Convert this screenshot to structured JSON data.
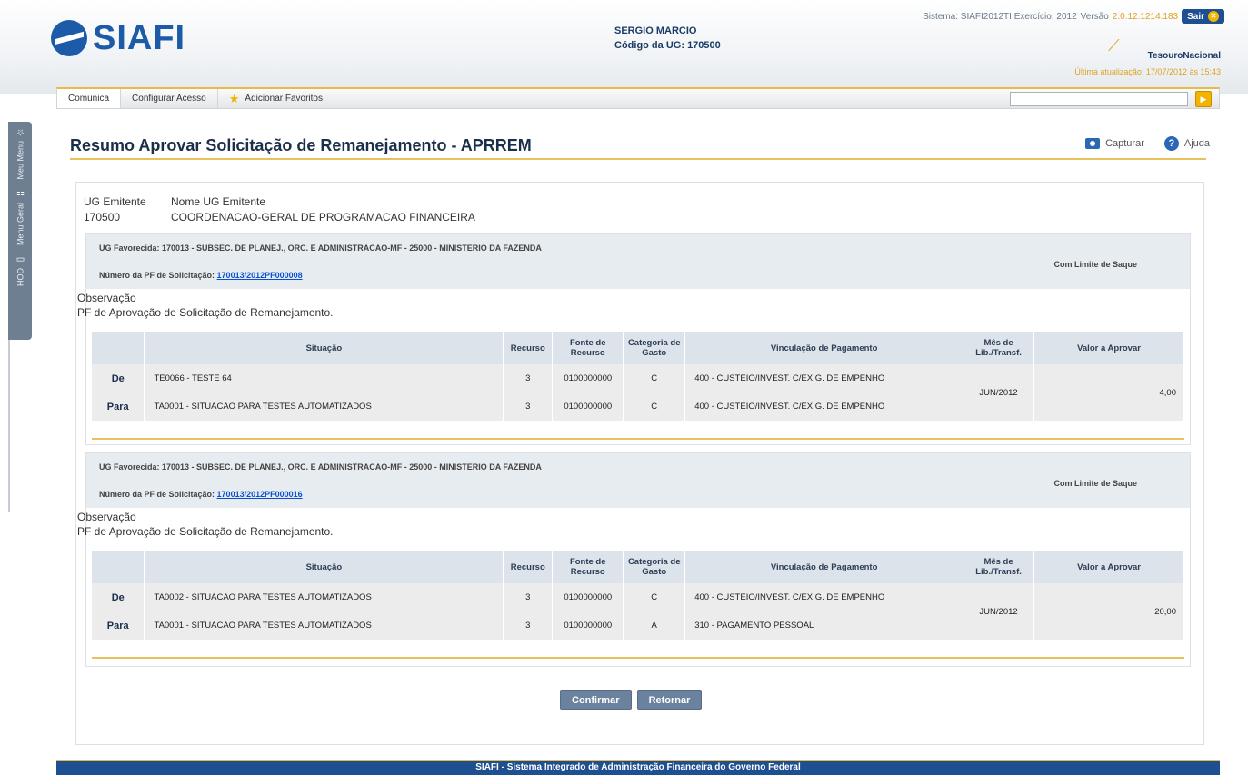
{
  "header": {
    "app_name": "SIAFI",
    "user_name": "SERGIO MARCIO",
    "ug_label": "Código da UG:",
    "ug_code": "170500",
    "sistema_label": "Sistema: SIAFI2012TI Exercício: 2012",
    "versao_label": "Versão",
    "versao_value": "2.0.12.1214.183",
    "sair_label": "Sair",
    "tesouro_label": "TesouroNacional",
    "updated": "Última atualização: 17/07/2012 às 15:43"
  },
  "menu": {
    "items": [
      "Comunica",
      "Configurar Acesso",
      "Adicionar Favoritos"
    ],
    "search_placeholder": ""
  },
  "sidebar": {
    "tabs": [
      "Meu Menu",
      "Menu Geral",
      "HOD"
    ]
  },
  "page": {
    "title": "Resumo Aprovar Solicitação de Remanejamento - APRREM",
    "capture_label": "Capturar",
    "help_label": "Ajuda"
  },
  "ug": {
    "emitente_label": "UG Emitente",
    "nome_label": "Nome UG Emitente",
    "emitente_value": "170500",
    "nome_value": "COORDENACAO-GERAL DE PROGRAMACAO FINANCEIRA"
  },
  "columns": [
    "Situação",
    "Recurso",
    "Fonte de Recurso",
    "Categoria de Gasto",
    "Vinculação de Pagamento",
    "Mês de Lib./Transf.",
    "Valor a Aprovar"
  ],
  "blocks": [
    {
      "favorecida": "UG Favorecida: 170013 - SUBSEC. DE PLANEJ., ORC. E ADMINISTRACAO-MF - 25000 - MINISTERIO DA FAZENDA",
      "pf_label": "Número da PF de Solicitação:",
      "pf_value": "170013/2012PF000008",
      "limite": "Com Limite de Saque",
      "obs_label": "Observação",
      "obs_text": "PF de Aprovação de Solicitação de Remanejamento.",
      "rows": [
        {
          "dir": "De",
          "situacao": "TE0066 - TESTE 64",
          "recurso": "3",
          "fonte": "0100000000",
          "categoria": "C",
          "vinculacao": "400 - CUSTEIO/INVEST. C/EXIG. DE EMPENHO"
        },
        {
          "dir": "Para",
          "situacao": "TA0001 - SITUACAO PARA TESTES AUTOMATIZADOS",
          "recurso": "3",
          "fonte": "0100000000",
          "categoria": "C",
          "vinculacao": "400 - CUSTEIO/INVEST. C/EXIG. DE EMPENHO"
        }
      ],
      "mes": "JUN/2012",
      "valor": "4,00"
    },
    {
      "favorecida": "UG Favorecida: 170013 - SUBSEC. DE PLANEJ., ORC. E ADMINISTRACAO-MF - 25000 - MINISTERIO DA FAZENDA",
      "pf_label": "Número da PF de Solicitação:",
      "pf_value": "170013/2012PF000016",
      "limite": "Com Limite de Saque",
      "obs_label": "Observação",
      "obs_text": "PF de Aprovação de Solicitação de Remanejamento.",
      "rows": [
        {
          "dir": "De",
          "situacao": "TA0002 - SITUACAO PARA TESTES AUTOMATIZADOS",
          "recurso": "3",
          "fonte": "0100000000",
          "categoria": "C",
          "vinculacao": "400 - CUSTEIO/INVEST. C/EXIG. DE EMPENHO"
        },
        {
          "dir": "Para",
          "situacao": "TA0001 - SITUACAO PARA TESTES AUTOMATIZADOS",
          "recurso": "3",
          "fonte": "0100000000",
          "categoria": "A",
          "vinculacao": "310 - PAGAMENTO PESSOAL"
        }
      ],
      "mes": "JUN/2012",
      "valor": "20,00"
    }
  ],
  "buttons": {
    "confirm": "Confirmar",
    "back": "Retornar"
  },
  "footer": {
    "text": "SIAFI - Sistema Integrado de Administração Financeira do Governo Federal"
  }
}
